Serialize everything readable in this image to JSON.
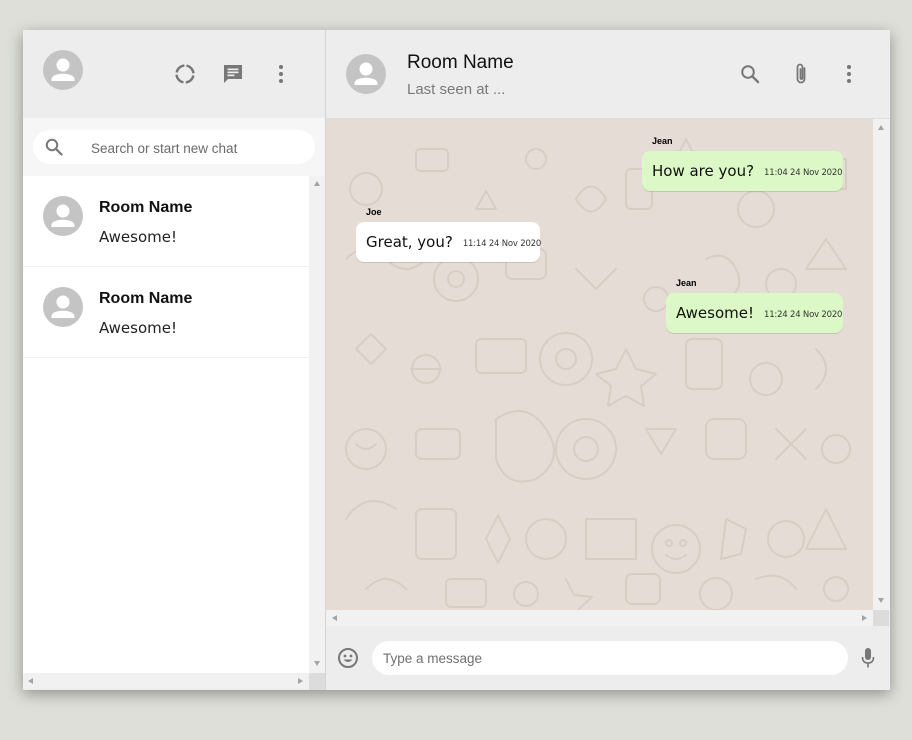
{
  "sidebar": {
    "icons": [
      "avatar-icon",
      "status-icon",
      "new-chat-icon",
      "menu-icon"
    ],
    "search": {
      "placeholder": "Search or start new chat"
    },
    "chats": [
      {
        "name": "Room Name",
        "last_message": "Awesome!"
      },
      {
        "name": "Room Name",
        "last_message": "Awesome!"
      }
    ]
  },
  "chat": {
    "header": {
      "title": "Room Name",
      "subtitle": "Last seen at ...",
      "icons": [
        "search-icon",
        "attach-icon",
        "menu-icon"
      ]
    },
    "messages": [
      {
        "sender": "Jean",
        "text": "How are you?",
        "time": "11:04 24 Nov 2020",
        "direction": "outgoing"
      },
      {
        "sender": "Joe",
        "text": "Great, you?",
        "time": "11:14 24 Nov 2020",
        "direction": "incoming"
      },
      {
        "sender": "Jean",
        "text": "Awesome!",
        "time": "11:24 24 Nov 2020",
        "direction": "outgoing"
      }
    ],
    "composer": {
      "placeholder": "Type a message"
    }
  },
  "colors": {
    "outgoing_bubble": "#dcf8c6",
    "incoming_bubble": "#ffffff",
    "chat_background": "#e5ddd5",
    "panel_background": "#ededed",
    "avatar": "#c4c4c4"
  }
}
